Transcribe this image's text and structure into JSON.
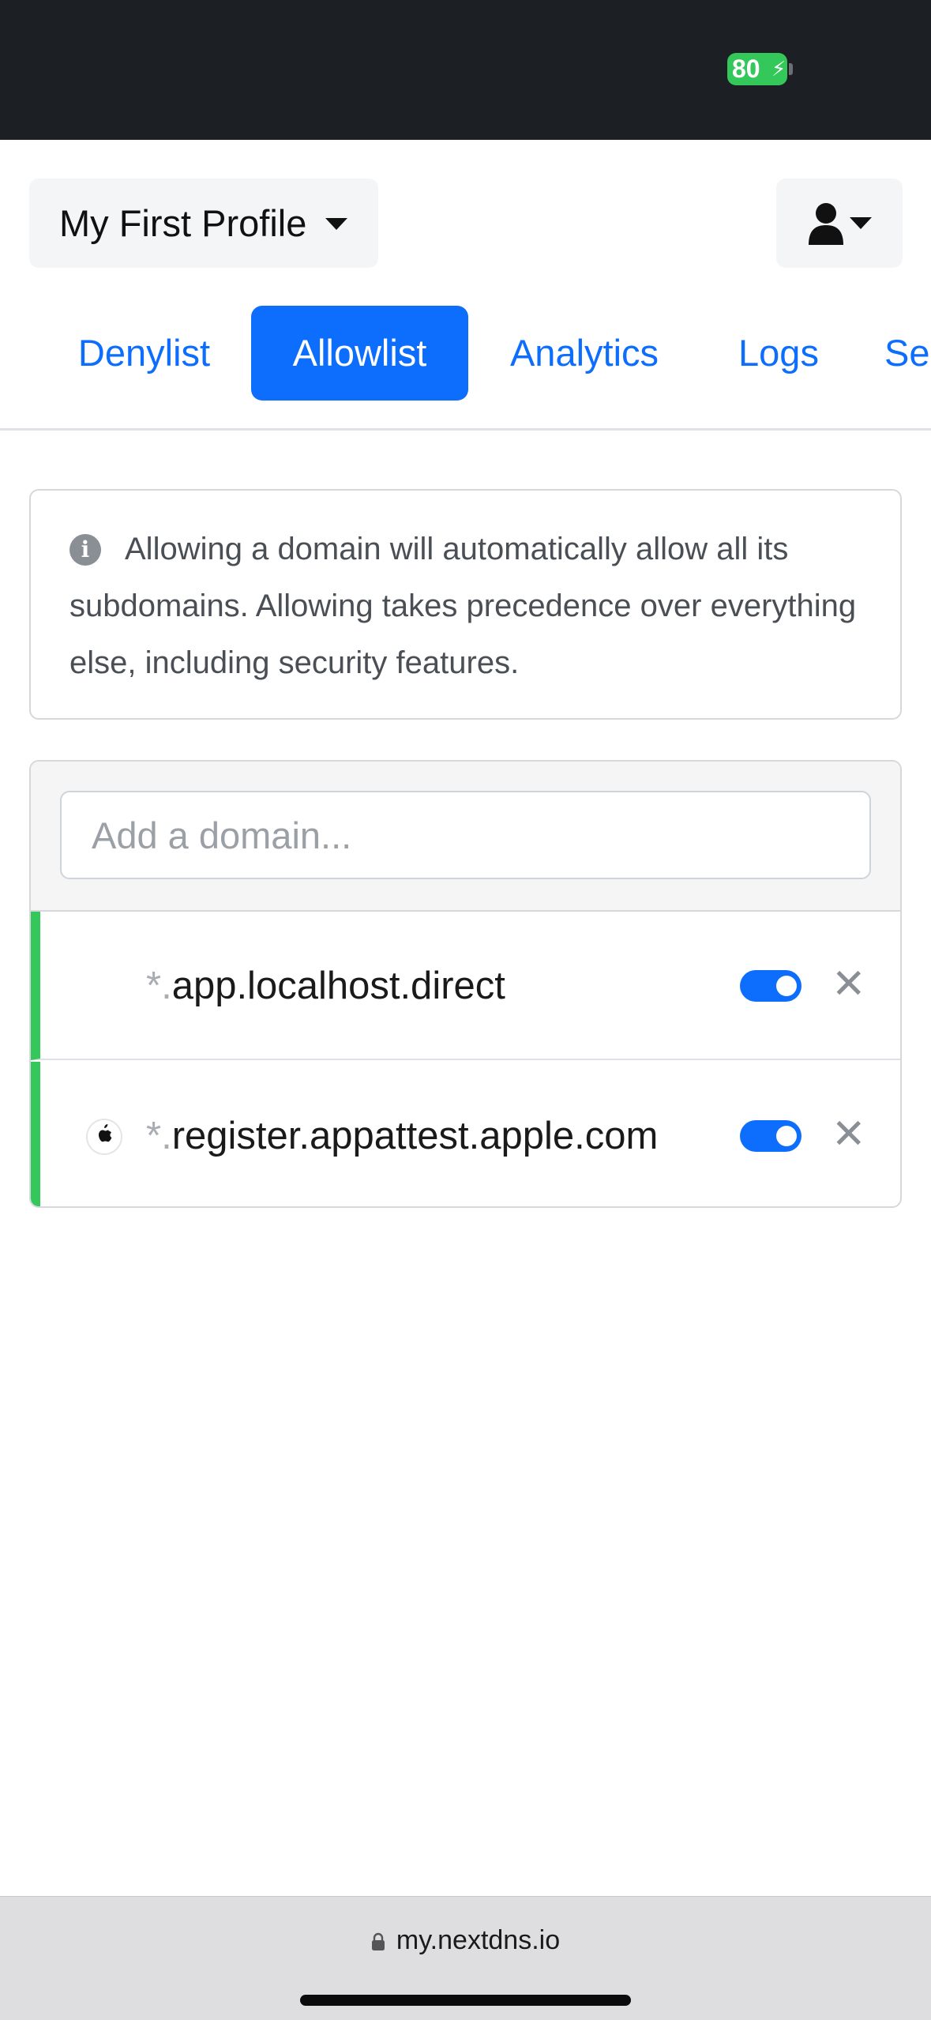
{
  "status_bar": {
    "battery_level": "80",
    "battery_color": "#34c759"
  },
  "header": {
    "profile_label": "My First Profile",
    "user_icon": "user-icon"
  },
  "tabs": [
    {
      "label": "Denylist",
      "active": false
    },
    {
      "label": "Allowlist",
      "active": true
    },
    {
      "label": "Analytics",
      "active": false
    },
    {
      "label": "Logs",
      "active": false
    },
    {
      "label": "Se",
      "active": false
    }
  ],
  "info": {
    "icon": "info-icon",
    "text": "Allowing a domain will automatically allow all its subdomains. Allowing takes precedence over everything else, including security features."
  },
  "allowlist": {
    "input_placeholder": "Add a domain...",
    "items": [
      {
        "wildcard": "*.",
        "domain": "app.localhost.direct",
        "enabled": true,
        "favicon": ""
      },
      {
        "wildcard": "*.",
        "domain": "register.appattest.apple.com",
        "enabled": true,
        "favicon": "apple-icon"
      }
    ]
  },
  "browser": {
    "url": "my.nextdns.io"
  },
  "colors": {
    "accent": "#0d6efd",
    "allowed": "#34c759"
  }
}
